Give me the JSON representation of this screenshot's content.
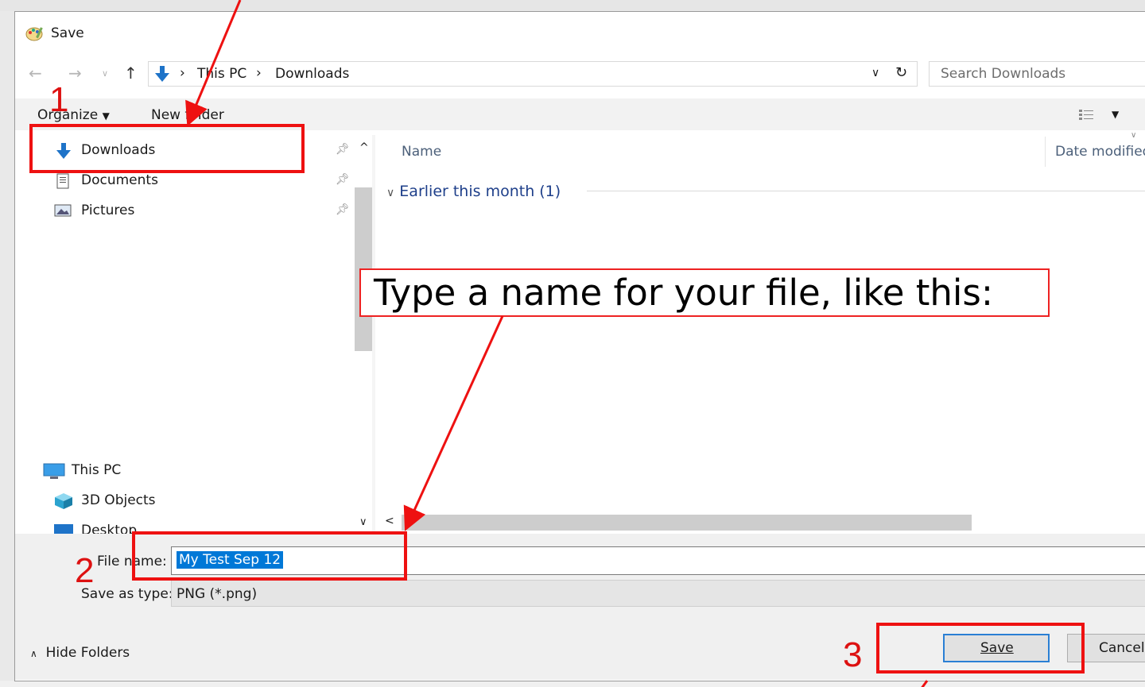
{
  "window": {
    "title": "Save"
  },
  "address": {
    "crumbs": [
      "This PC",
      "Downloads"
    ]
  },
  "search": {
    "placeholder": "Search Downloads"
  },
  "toolbar": {
    "organize": "Organize",
    "new_folder": "New folder"
  },
  "nav": {
    "quick_access": [
      "Downloads",
      "Documents",
      "Pictures"
    ],
    "this_pc": "This PC",
    "pc_items": [
      "3D Objects",
      "Desktop"
    ]
  },
  "columns": {
    "name": "Name",
    "date": "Date modified"
  },
  "group": {
    "label": "Earlier this month (1)"
  },
  "footer": {
    "file_name_label": "File name:",
    "file_name_value": "My Test Sep 12",
    "type_label": "Save as type:",
    "type_value": "PNG (*.png)",
    "hide_folders": "Hide Folders",
    "save": "Save",
    "cancel": "Cancel"
  },
  "annotations": {
    "callout": "Type a name for your file, like this:",
    "step1": "1",
    "step2": "2",
    "step3": "3"
  },
  "colors": {
    "annotation_red": "#ee1111",
    "selection": "#0078d7",
    "folder_blue": "#1e73c8"
  },
  "icons": [
    "paint-app-icon",
    "back-arrow-icon",
    "forward-arrow-icon",
    "up-arrow-icon",
    "download-arrow-icon",
    "refresh-icon",
    "chevron-down-icon",
    "pin-icon",
    "document-icon",
    "pictures-icon",
    "this-pc-icon",
    "3d-objects-icon",
    "desktop-icon",
    "view-options-icon"
  ]
}
